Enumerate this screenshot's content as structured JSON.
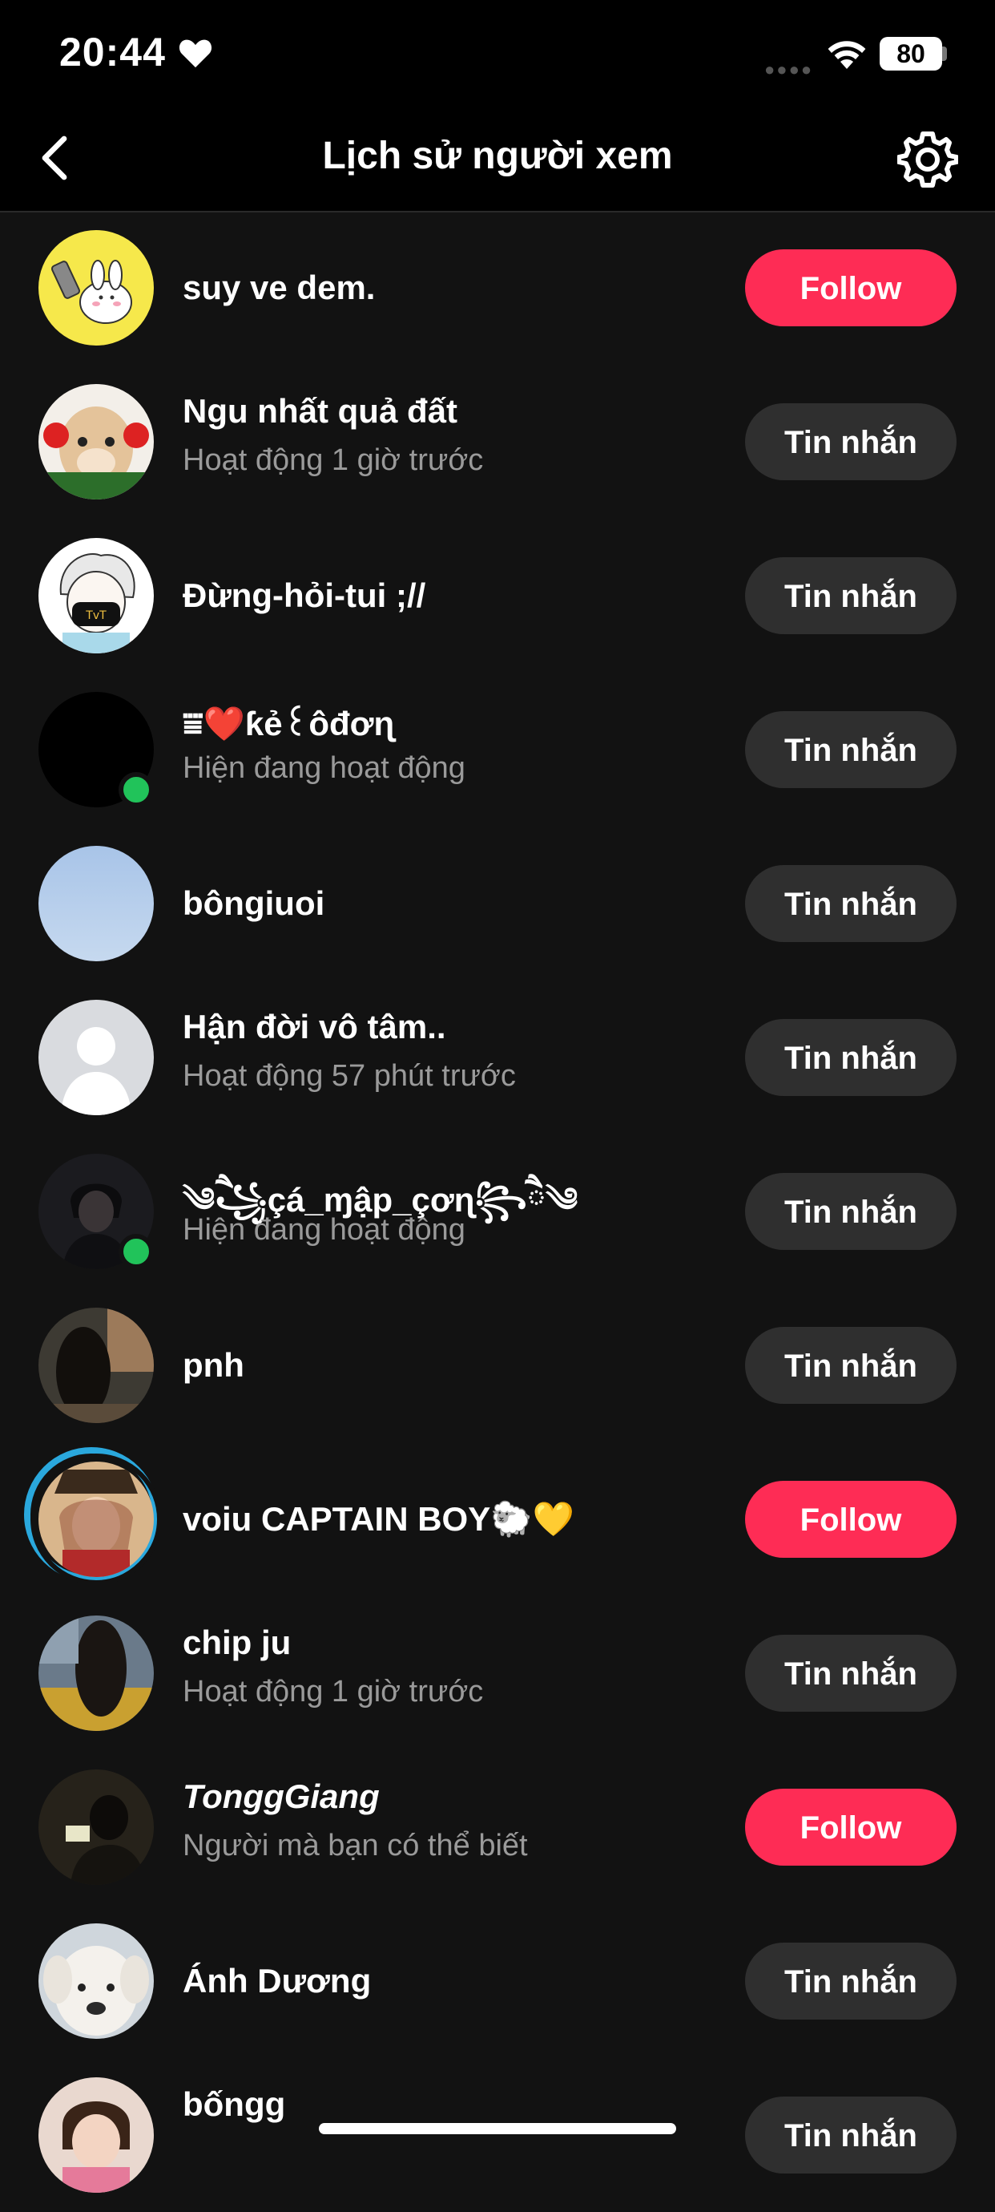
{
  "status_bar": {
    "time": "20:44",
    "battery": "80"
  },
  "header": {
    "title": "Lịch sử người xem"
  },
  "colors": {
    "follow": "#fe2c55",
    "message": "#2f2f2f",
    "online": "#21c35a",
    "background": "#121212"
  },
  "rows": [
    {
      "name": "suy ve dem.",
      "sub": "",
      "button": "Follow"
    },
    {
      "name": "Ngu nhất quả đất",
      "sub": "Hoạt động 1 giờ trước",
      "button": "Tin nhắn"
    },
    {
      "name": "Đừng-hỏi-tui ;//",
      "sub": "",
      "button": "Tin nhắn"
    },
    {
      "name": "⩸❤️ƙẻ꒰ôđơɳ",
      "sub": "Hiện đang hoạt động",
      "button": "Tin nhắn"
    },
    {
      "name": "bôngiuoi",
      "sub": "",
      "button": "Tin nhắn"
    },
    {
      "name": "Hận đời vô tâm..",
      "sub": "Hoạt động 57 phút trước",
      "button": "Tin nhắn"
    },
    {
      "name": "༄ཻ꧁çá_ɱập_çơɳ꧂ཻ༄",
      "sub": "Hiện đang hoạt động",
      "button": "Tin nhắn"
    },
    {
      "name": "pnh",
      "sub": "",
      "button": "Tin nhắn"
    },
    {
      "name": "voiu CAPTAIN BOY🐑💛",
      "sub": "",
      "button": "Follow"
    },
    {
      "name": "chip ju",
      "sub": "Hoạt động 1 giờ trước",
      "button": "Tin nhắn"
    },
    {
      "name": "TonggGiang",
      "sub": "Người mà bạn có thể biết",
      "button": "Follow"
    },
    {
      "name": "Ánh Dương",
      "sub": "",
      "button": "Tin nhắn"
    },
    {
      "name": "bốngg",
      "sub": "",
      "button": "Tin nhắn"
    }
  ]
}
